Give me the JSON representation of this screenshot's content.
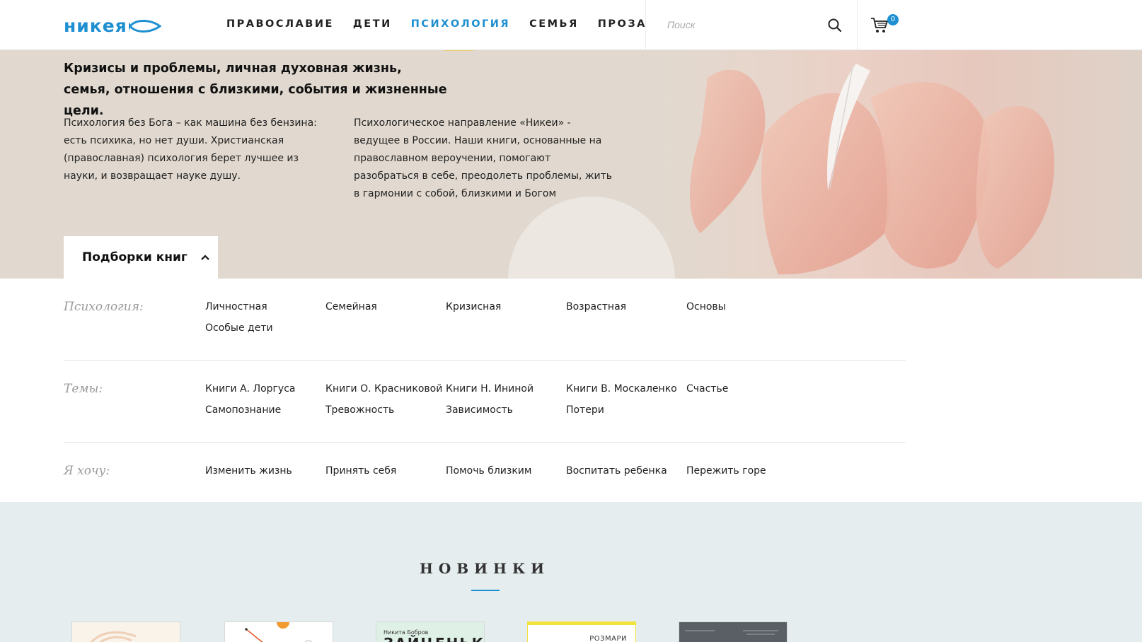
{
  "header": {
    "logo_text": "никея",
    "nav": [
      {
        "label": "ПРАВОСЛАВИЕ",
        "active": false
      },
      {
        "label": "ДЕТИ",
        "active": false
      },
      {
        "label": "ПСИХОЛОГИЯ",
        "active": true
      },
      {
        "label": "СЕМЬЯ",
        "active": false
      },
      {
        "label": "ПРОЗА",
        "active": false
      }
    ],
    "search_placeholder": "Поиск",
    "cart_count": "0",
    "accent_color": "#1e8fd0"
  },
  "hero": {
    "lead_line1": "Кризисы и проблемы, личная духовная жизнь,",
    "lead_line2": "семья, отношения с близкими, события и жизненные цели.",
    "col1": "Психология без Бога – как машина без бензина: есть психика, но нет души. Христианская (православная) психология берет лучшее из науки, и возвращает науке душу.",
    "col2": "Психологическое направление «Никеи» - ведущее в России. Наши книги, основанные на православном вероучении, помогают разобраться в себе, преодолеть проблемы, жить в гармонии с собой, близкими и Богом",
    "collections_label": "Подборки книг",
    "background_color": "#e1d9cf"
  },
  "filters": [
    {
      "label": "Психология:",
      "items": [
        "Личностная",
        "Семейная",
        "Кризисная",
        "Возрастная",
        "Основы",
        "Особые дети"
      ]
    },
    {
      "label": "Темы:",
      "items": [
        "Книги А. Лоргуса",
        "Книги О. Красниковой",
        "Книги Н. Ининой",
        "Книги В. Москаленко",
        "Счастье",
        "Самопознание",
        "Тревожность",
        "Зависимость",
        "Потери"
      ]
    },
    {
      "label": "Я хочу:",
      "items": [
        "Изменить жизнь",
        "Принять себя",
        "Помочь близким",
        "Воспитать ребенка",
        "Пережить горе"
      ]
    }
  ],
  "novelties": {
    "title": "НОВИНКИ",
    "books": [
      {
        "author": "",
        "title": ""
      },
      {
        "author": "",
        "title": ""
      },
      {
        "author": "Никита Бобров",
        "title": "ЗАЙЦЕНЬКА"
      },
      {
        "author": "",
        "title": "РОЗМАРИ"
      },
      {
        "author": "",
        "title": ""
      }
    ],
    "background_color": "#e5edee"
  }
}
